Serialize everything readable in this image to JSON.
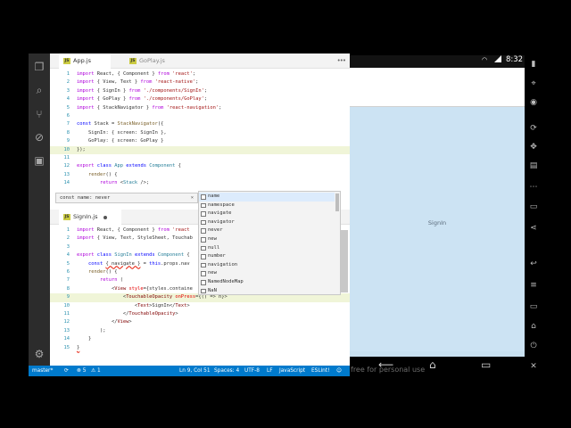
{
  "vscode": {
    "top_tabs": [
      {
        "label": "App.js",
        "active": true
      },
      {
        "label": "GoPlay.js",
        "active": false
      }
    ],
    "bottom_tabs": [
      {
        "label": "SignIn.js",
        "active": true,
        "modified": true
      }
    ],
    "app_js_lines": [
      {
        "n": "1"
      },
      {
        "n": "2"
      },
      {
        "n": "3"
      },
      {
        "n": "4"
      },
      {
        "n": "5"
      },
      {
        "n": "6"
      },
      {
        "n": "7"
      },
      {
        "n": "8"
      },
      {
        "n": "9"
      },
      {
        "n": "10"
      },
      {
        "n": "11"
      },
      {
        "n": "12"
      },
      {
        "n": "13"
      },
      {
        "n": "14"
      }
    ],
    "signin_js_lines": [
      {
        "n": "1"
      },
      {
        "n": "2"
      },
      {
        "n": "3"
      },
      {
        "n": "4"
      },
      {
        "n": "5"
      },
      {
        "n": "6"
      },
      {
        "n": "7"
      },
      {
        "n": "8"
      },
      {
        "n": "9"
      },
      {
        "n": "10"
      },
      {
        "n": "11"
      },
      {
        "n": "12"
      },
      {
        "n": "13"
      },
      {
        "n": "14"
      },
      {
        "n": "15"
      }
    ],
    "hover_tip": "const name: never",
    "hover_close": "×",
    "suggestions": [
      "name",
      "namespace",
      "navigate",
      "navigator",
      "never",
      "new",
      "null",
      "number",
      "navigation",
      "new",
      "NamedNodeMap",
      "NaN"
    ],
    "status_bar": {
      "branch": "master*",
      "sync": "⟳",
      "errors": "⊗ 5",
      "warnings": "⚠ 1",
      "position": "Ln 9, Col 51",
      "spaces": "Spaces: 4",
      "encoding": "UTF-8",
      "eol": "LF",
      "language": "JavaScript",
      "linter": "ESLint!",
      "feedback": "☺"
    }
  },
  "android": {
    "time": "8:32",
    "screen_title": "SignIn",
    "watermark": "free for personal use"
  },
  "colors": {
    "accent": "#007acc",
    "activity_bar": "#2c2c2c",
    "emulator_bg": "#cce3f3"
  }
}
